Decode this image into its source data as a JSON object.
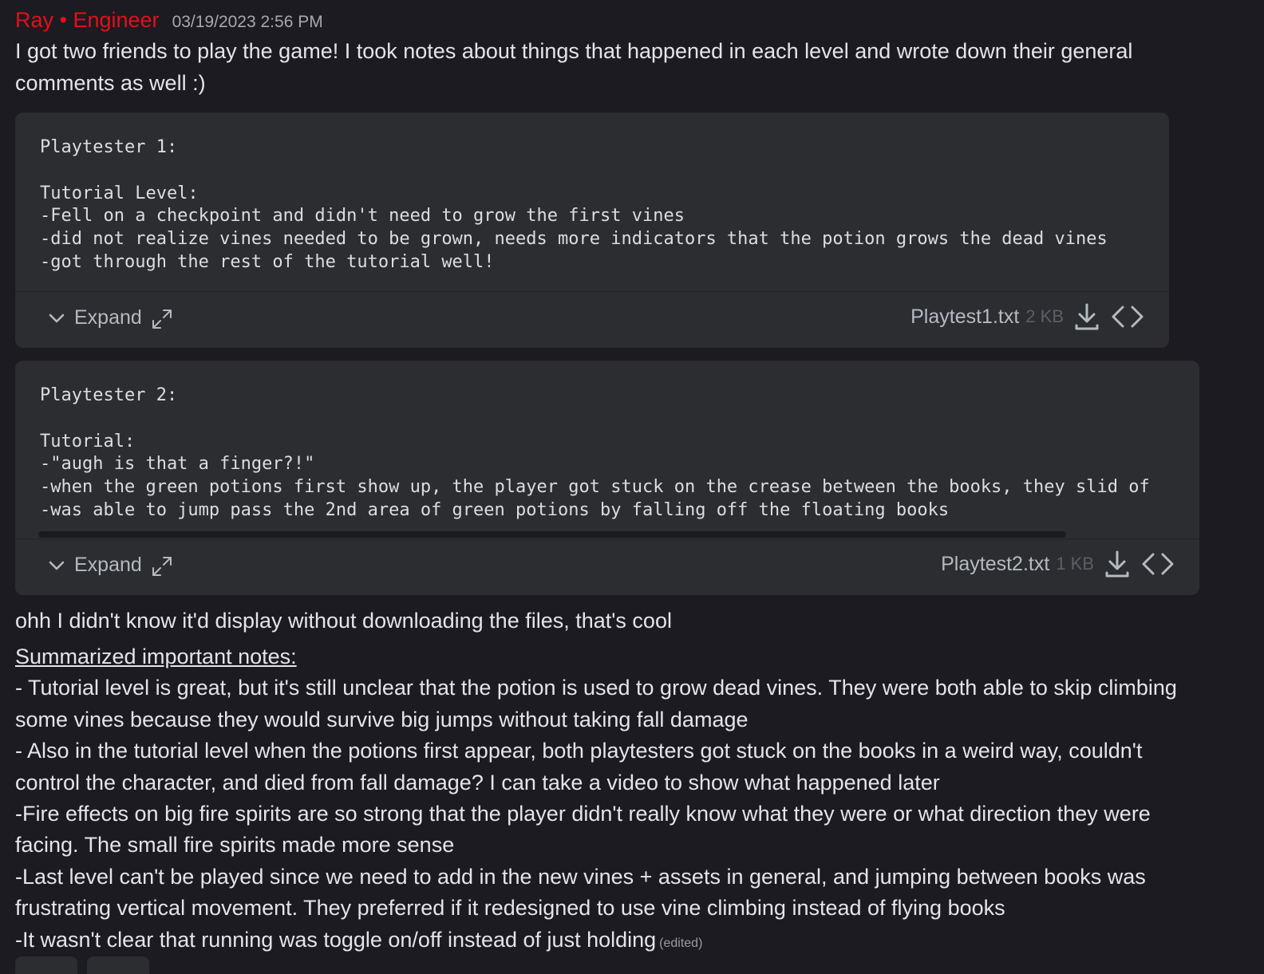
{
  "message": {
    "author": "Ray • Engineer",
    "timestamp": "03/19/2023 2:56 PM",
    "author_color": "#e3101a",
    "intro": "I got two friends to play the game! I took notes about things that happened in each level and wrote down their general comments as well :)"
  },
  "attachments": [
    {
      "content": "Playtester 1:\n\nTutorial Level:\n-Fell on a checkpoint and didn't need to grow the first vines\n-did not realize vines needed to be grown, needs more indicators that the potion grows the dead vines\n-got through the rest of the tutorial well!",
      "expand_label": "Expand",
      "filename": "Playtest1.txt",
      "size": "2 KB"
    },
    {
      "content": "Playtester 2:\n\nTutorial:\n-\"augh is that a finger?!\"\n-when the green potions first show up, the player got stuck on the crease between the books, they slid of\n-was able to jump pass the 2nd area of green potions by falling off the floating books",
      "expand_label": "Expand",
      "filename": "Playtest2.txt",
      "size": "1 KB"
    }
  ],
  "followup": "ohh I didn't know it'd display without downloading the files, that's cool",
  "notes": {
    "title": "Summarized important notes:",
    "items": [
      "- Tutorial level is great, but it's still unclear that the potion is used to grow dead vines. They were both able to skip climbing some vines because they would survive big jumps without taking fall damage",
      "- Also in the tutorial level when the potions first appear, both playtesters got stuck on the books in a weird way, couldn't control the character, and died from fall damage? I can take a video to show what happened later",
      "-Fire effects on big fire spirits are so strong that the player didn't really know what they were or what direction they were facing. The small fire spirits made more sense",
      "-Last level can't be played since we need to add in the new vines + assets in general, and jumping between books was frustrating vertical movement. They preferred if it redesigned to use vine climbing instead of flying books",
      "-It wasn't clear that running was toggle on/off instead of just holding"
    ],
    "edited": "(edited)"
  },
  "icons": {
    "expand": "chevron-down-icon",
    "fullscreen": "expand-arrows-icon",
    "download": "download-icon",
    "view_code": "code-brackets-icon"
  },
  "colors": {
    "background": "#1c1b21",
    "card": "#2b2d31",
    "text": "#dbdee1",
    "muted": "#b5bac1"
  }
}
